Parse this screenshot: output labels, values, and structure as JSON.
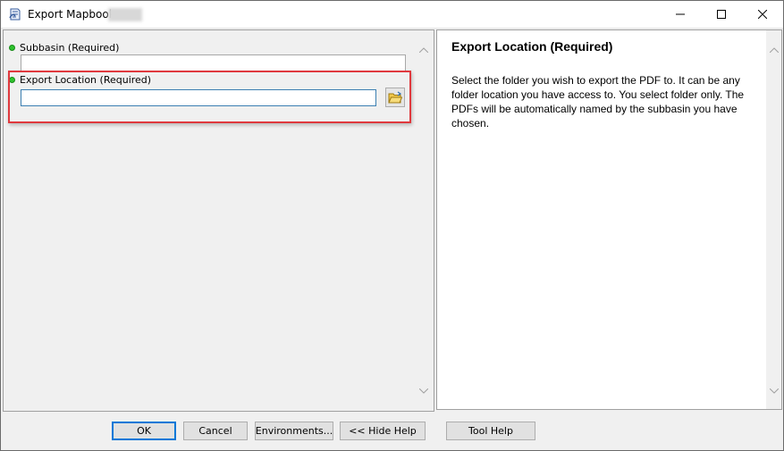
{
  "window": {
    "title": "Export Mapbook"
  },
  "params": [
    {
      "label": "Subbasin (Required)",
      "value": ""
    },
    {
      "label": "Export Location (Required)",
      "value": ""
    }
  ],
  "help": {
    "title": "Export Location (Required)",
    "body": "Select the folder you wish to export the PDF to. It can be any folder location you have access to. You select folder only. The PDFs will be automatically named by the subbasin you have chosen."
  },
  "buttons": {
    "ok": "OK",
    "cancel": "Cancel",
    "environments": "Environments...",
    "hide_help": "<< Hide Help",
    "tool_help": "Tool Help"
  },
  "colors": {
    "required_dot": "#2fc22f",
    "highlight": "#e0393e",
    "focus_border": "#3c7fb1"
  },
  "icons": [
    "app-icon",
    "minimize-icon",
    "maximize-icon",
    "close-icon",
    "folder-open-icon",
    "scroll-up-icon",
    "scroll-down-icon"
  ]
}
